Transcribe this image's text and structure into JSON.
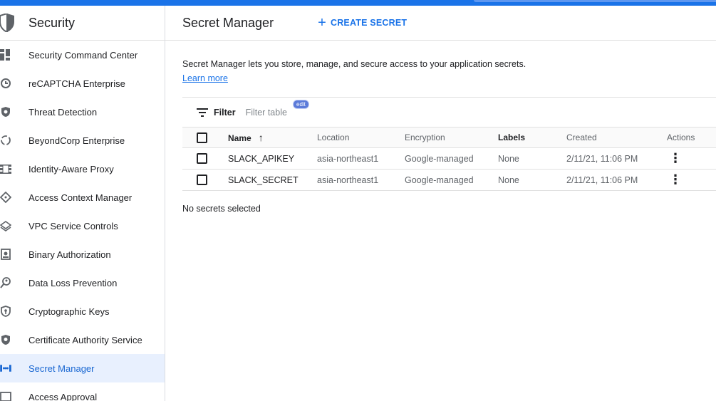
{
  "sidebar": {
    "title": "Security",
    "items": [
      {
        "label": "Security Command Center",
        "icon": "dashboard-icon"
      },
      {
        "label": "reCAPTCHA Enterprise",
        "icon": "recaptcha-icon"
      },
      {
        "label": "Threat Detection",
        "icon": "shield-icon"
      },
      {
        "label": "BeyondCorp Enterprise",
        "icon": "beyondcorp-icon"
      },
      {
        "label": "Identity-Aware Proxy",
        "icon": "proxy-icon"
      },
      {
        "label": "Access Context Manager",
        "icon": "diamond-icon"
      },
      {
        "label": "VPC Service Controls",
        "icon": "layers-icon"
      },
      {
        "label": "Binary Authorization",
        "icon": "badge-icon"
      },
      {
        "label": "Data Loss Prevention",
        "icon": "search-person-icon"
      },
      {
        "label": "Cryptographic Keys",
        "icon": "key-shield-icon"
      },
      {
        "label": "Certificate Authority Service",
        "icon": "cert-shield-icon"
      },
      {
        "label": "Secret Manager",
        "icon": "brackets-icon",
        "active": true
      },
      {
        "label": "Access Approval",
        "icon": "approval-icon"
      }
    ]
  },
  "header": {
    "title": "Secret Manager",
    "create_label": "CREATE SECRET"
  },
  "main": {
    "description": "Secret Manager lets you store, manage, and secure access to your application secrets.",
    "learn_more": "Learn more",
    "filter_label": "Filter",
    "filter_placeholder": "Filter table",
    "edit_badge": "edit",
    "no_selection": "No secrets selected"
  },
  "table": {
    "columns": [
      "Name",
      "Location",
      "Encryption",
      "Labels",
      "Created",
      "Actions"
    ],
    "rows": [
      {
        "name": "SLACK_APIKEY",
        "location": "asia-northeast1",
        "encryption": "Google-managed",
        "labels": "None",
        "created": "2/11/21, 11:06 PM"
      },
      {
        "name": "SLACK_SECRET",
        "location": "asia-northeast1",
        "encryption": "Google-managed",
        "labels": "None",
        "created": "2/11/21, 11:06 PM"
      }
    ]
  },
  "colors": {
    "accent": "#1a73e8",
    "active_bg": "#e8f0fe"
  }
}
